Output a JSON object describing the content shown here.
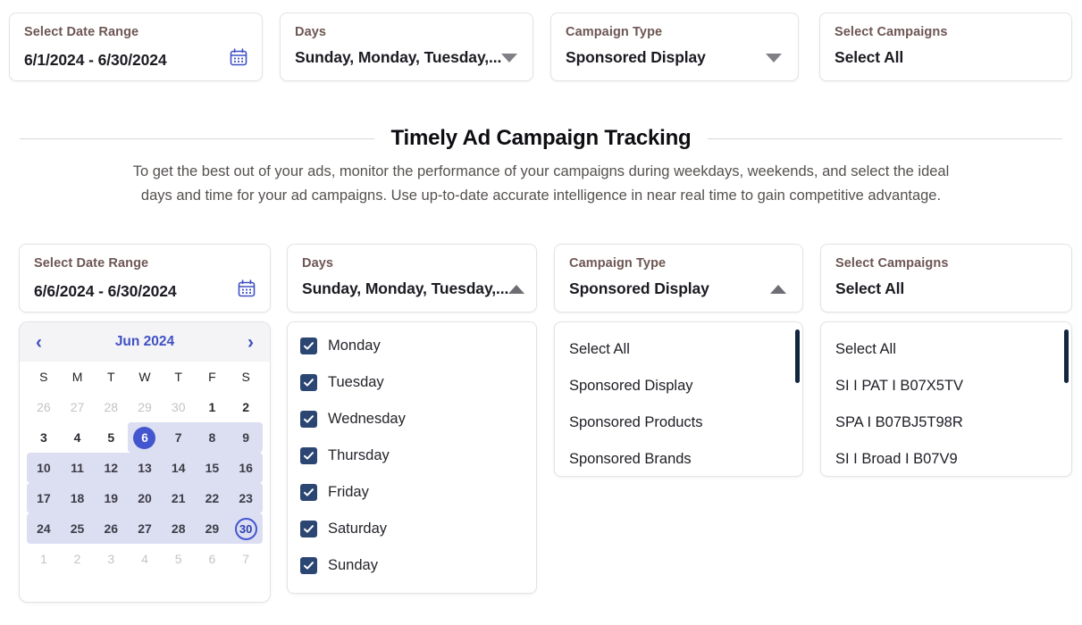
{
  "top_filters": [
    {
      "label": "Select Date Range",
      "value": "6/1/2024 - 6/30/2024",
      "icon": "calendar-icon",
      "control": "date-range"
    },
    {
      "label": "Days",
      "value": "Sunday, Monday, Tuesday,...",
      "icon": "chevron-down-icon",
      "control": "days"
    },
    {
      "label": "Campaign Type",
      "value": "Sponsored Display",
      "icon": "chevron-down-icon",
      "control": "campaign-type"
    },
    {
      "label": "Select Campaigns",
      "value": "Select All",
      "icon": "none",
      "control": "campaigns"
    }
  ],
  "header": {
    "title": "Timely Ad Campaign Tracking",
    "subtitle_line1": "To get the best out of your ads, monitor the performance of your campaigns during weekdays, weekends, and select the ideal",
    "subtitle_line2": "days and time for your ad campaigns. Use up-to-date accurate intelligence in near real time to gain competitive advantage."
  },
  "bottom_filters": [
    {
      "label": "Select Date Range",
      "value": "6/6/2024 - 6/30/2024",
      "icon": "calendar-icon",
      "control": "date-range"
    },
    {
      "label": "Days",
      "value": "Sunday, Monday, Tuesday,...",
      "icon": "chevron-up-icon",
      "control": "days"
    },
    {
      "label": "Campaign Type",
      "value": "Sponsored Display",
      "icon": "chevron-up-icon",
      "control": "campaign-type"
    },
    {
      "label": "Select Campaigns",
      "value": "Select All",
      "icon": "none",
      "control": "campaigns"
    }
  ],
  "calendar": {
    "month_label": "Jun 2024",
    "prev_icon": "chevron-left-icon",
    "next_icon": "chevron-right-icon",
    "day_initials": [
      "S",
      "M",
      "T",
      "W",
      "T",
      "F",
      "S"
    ],
    "range_start": 6,
    "range_end": 30,
    "weeks": [
      [
        {
          "n": "26",
          "t": "muted"
        },
        {
          "n": "27",
          "t": "muted"
        },
        {
          "n": "28",
          "t": "muted"
        },
        {
          "n": "29",
          "t": "muted"
        },
        {
          "n": "30",
          "t": "muted"
        },
        {
          "n": "1",
          "t": "day"
        },
        {
          "n": "2",
          "t": "day"
        }
      ],
      [
        {
          "n": "3",
          "t": "day"
        },
        {
          "n": "4",
          "t": "day"
        },
        {
          "n": "5",
          "t": "day"
        },
        {
          "n": "6",
          "t": "start"
        },
        {
          "n": "7",
          "t": "inrange"
        },
        {
          "n": "8",
          "t": "inrange"
        },
        {
          "n": "9",
          "t": "inrange"
        }
      ],
      [
        {
          "n": "10",
          "t": "inrange"
        },
        {
          "n": "11",
          "t": "inrange"
        },
        {
          "n": "12",
          "t": "inrange"
        },
        {
          "n": "13",
          "t": "inrange"
        },
        {
          "n": "14",
          "t": "inrange"
        },
        {
          "n": "15",
          "t": "inrange"
        },
        {
          "n": "16",
          "t": "inrange"
        }
      ],
      [
        {
          "n": "17",
          "t": "inrange"
        },
        {
          "n": "18",
          "t": "inrange"
        },
        {
          "n": "19",
          "t": "inrange"
        },
        {
          "n": "20",
          "t": "inrange"
        },
        {
          "n": "21",
          "t": "inrange"
        },
        {
          "n": "22",
          "t": "inrange"
        },
        {
          "n": "23",
          "t": "inrange"
        }
      ],
      [
        {
          "n": "24",
          "t": "inrange"
        },
        {
          "n": "25",
          "t": "inrange"
        },
        {
          "n": "26",
          "t": "inrange"
        },
        {
          "n": "27",
          "t": "inrange"
        },
        {
          "n": "28",
          "t": "inrange"
        },
        {
          "n": "29",
          "t": "inrange"
        },
        {
          "n": "30",
          "t": "end"
        }
      ],
      [
        {
          "n": "1",
          "t": "muted"
        },
        {
          "n": "2",
          "t": "muted"
        },
        {
          "n": "3",
          "t": "muted"
        },
        {
          "n": "4",
          "t": "muted"
        },
        {
          "n": "5",
          "t": "muted"
        },
        {
          "n": "6",
          "t": "muted"
        },
        {
          "n": "7",
          "t": "muted"
        }
      ]
    ]
  },
  "days_popup": {
    "items": [
      {
        "label": "Monday",
        "checked": true
      },
      {
        "label": "Tuesday",
        "checked": true
      },
      {
        "label": "Wednesday",
        "checked": true
      },
      {
        "label": "Thursday",
        "checked": true
      },
      {
        "label": "Friday",
        "checked": true
      },
      {
        "label": "Saturday",
        "checked": true
      },
      {
        "label": "Sunday",
        "checked": true
      }
    ]
  },
  "campaign_type_popup": {
    "items": [
      "Select All",
      "Sponsored Display",
      "Sponsored Products",
      "Sponsored Brands"
    ],
    "scrollbar": true
  },
  "campaigns_popup": {
    "items": [
      "Select All",
      "SI I PAT I B07X5TV",
      "SPA I B07BJ5T98R",
      "SI I Broad I B07V9"
    ],
    "scrollbar": true
  },
  "colors": {
    "accent_blue": "#4456cf",
    "range_band": "#dcdef2",
    "checkbox_navy": "#2c4673",
    "scrollbar_navy": "#12263f",
    "label_brown": "#6d5653"
  }
}
